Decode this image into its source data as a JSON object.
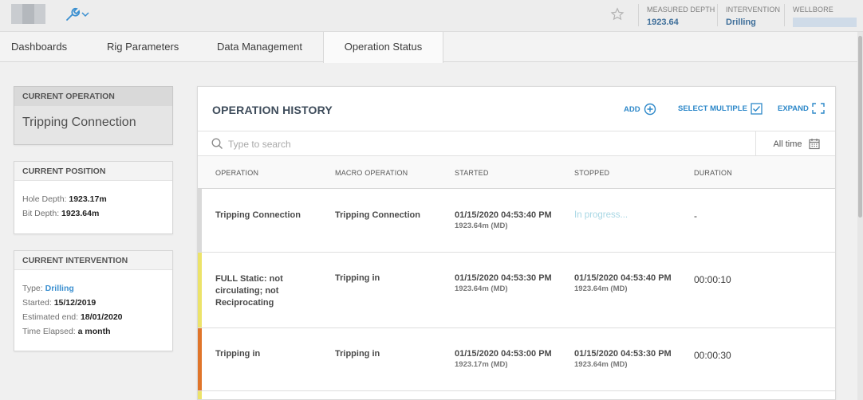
{
  "header": {
    "measured_depth_label": "MEASURED DEPTH",
    "measured_depth_value": "1923.64",
    "intervention_label": "INTERVENTION",
    "intervention_value": "Drilling",
    "wellbore_label": "WELLBORE"
  },
  "tabs": [
    {
      "label": "Dashboards"
    },
    {
      "label": "Rig Parameters"
    },
    {
      "label": "Data Management"
    },
    {
      "label": "Operation Status",
      "active": true
    }
  ],
  "current_operation": {
    "heading": "CURRENT OPERATION",
    "name": "Tripping Connection"
  },
  "current_position": {
    "heading": "CURRENT POSITION",
    "hole_depth_label": "Hole Depth:",
    "hole_depth_value": "1923.17m",
    "bit_depth_label": "Bit Depth:",
    "bit_depth_value": "1923.64m"
  },
  "current_intervention": {
    "heading": "CURRENT INTERVENTION",
    "type_label": "Type:",
    "type_value": "Drilling",
    "started_label": "Started:",
    "started_value": "15/12/2019",
    "estimated_end_label": "Estimated end:",
    "estimated_end_value": "18/01/2020",
    "time_elapsed_label": "Time Elapsed:",
    "time_elapsed_value": "a month"
  },
  "history": {
    "title": "OPERATION HISTORY",
    "add_label": "ADD",
    "select_multiple_label": "SELECT MULTIPLE",
    "expand_label": "EXPAND",
    "search_placeholder": "Type to search",
    "time_filter": "All time",
    "columns": [
      "OPERATION",
      "MACRO OPERATION",
      "STARTED",
      "STOPPED",
      "DURATION"
    ],
    "rows": [
      {
        "operation": "Tripping Connection",
        "macro": "Tripping Connection",
        "started": "01/15/2020 04:53:40 PM",
        "started_depth": "1923.64m (MD)",
        "stopped": "In progress...",
        "stopped_depth": "",
        "duration": "-",
        "color": "#d9d9d9"
      },
      {
        "operation": "FULL Static: not circulating; not Reciprocating",
        "macro": "Tripping in",
        "started": "01/15/2020 04:53:30 PM",
        "started_depth": "1923.64m (MD)",
        "stopped": "01/15/2020 04:53:40 PM",
        "stopped_depth": "1923.64m (MD)",
        "duration": "00:00:10",
        "color": "#ece36a"
      },
      {
        "operation": "Tripping in",
        "macro": "Tripping in",
        "started": "01/15/2020 04:53:00 PM",
        "started_depth": "1923.17m (MD)",
        "stopped": "01/15/2020 04:53:30 PM",
        "stopped_depth": "1923.64m (MD)",
        "duration": "00:00:30",
        "color": "#e0752a"
      }
    ]
  },
  "colors": {
    "accent": "#2d88c9",
    "progress_text": "#a8d7e4"
  }
}
